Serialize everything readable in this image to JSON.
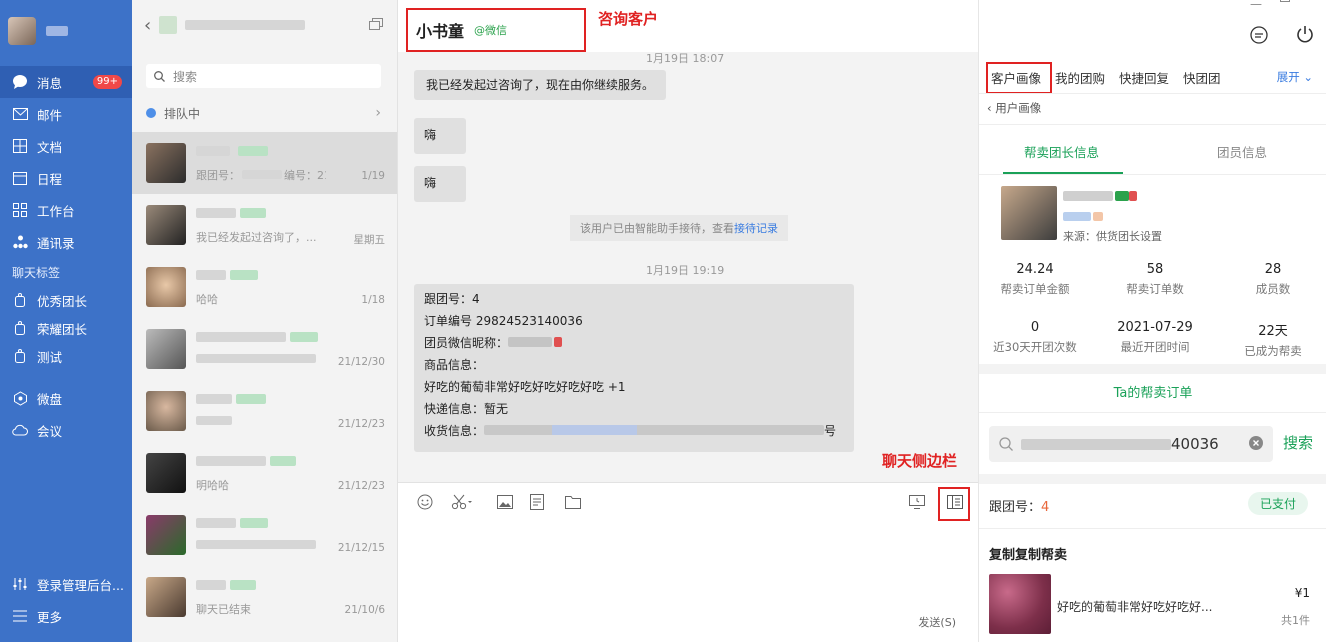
{
  "nav": {
    "items": [
      {
        "label": "消息",
        "badge": "99+"
      },
      {
        "label": "邮件"
      },
      {
        "label": "文档"
      },
      {
        "label": "日程"
      },
      {
        "label": "工作台"
      },
      {
        "label": "通讯录"
      }
    ],
    "section_label": "聊天标签",
    "tags": [
      {
        "label": "优秀团长"
      },
      {
        "label": "荣耀团长"
      },
      {
        "label": "测试"
      }
    ],
    "items2": [
      {
        "label": "微盘"
      },
      {
        "label": "会议"
      }
    ],
    "bottom": [
      {
        "label": "登录管理后台..."
      },
      {
        "label": "更多"
      }
    ]
  },
  "conversations": {
    "search_placeholder": "搜索",
    "queue_label": "排队中",
    "items": [
      {
        "preview": "跟团号：",
        "preview_tail": "编号：210...",
        "time": "1/19"
      },
      {
        "preview": "我已经发起过咨询了，...",
        "time": "星期五"
      },
      {
        "preview": "哈哈",
        "time": "1/18"
      },
      {
        "preview": "",
        "time": "21/12/30"
      },
      {
        "preview": "",
        "time": "21/12/23"
      },
      {
        "preview": "明哈哈",
        "time": "21/12/23"
      },
      {
        "preview": "",
        "time": "21/12/15"
      },
      {
        "preview": "聊天已结束",
        "time": "21/10/6"
      }
    ]
  },
  "chat": {
    "name": "小书童",
    "source": "@微信",
    "annotation_title": "咨询客户",
    "annotation_sidebar": "聊天侧边栏",
    "ts1": "1月19日 18:07",
    "msg1": "我已经发起过咨询了，现在由你继续服务。",
    "msg2": "嗨",
    "msg3": "嗨",
    "system_text": "该用户已由智能助手接待，查看",
    "system_link": "接待记录",
    "ts2": "1月19日 19:19",
    "order_lines": [
      "跟团号：4",
      "订单编号 29824523140036",
      "团员微信昵称：",
      "商品信息：",
      "好吃的葡萄非常好吃好吃好吃好吃 +1",
      "快递信息：暂无",
      "收货信息："
    ],
    "order_tail": "号",
    "send_label": "发送(S)"
  },
  "side": {
    "tabs": [
      "客户画像",
      "我的团购",
      "快捷回复",
      "快团团"
    ],
    "expand": "展开",
    "crumb": "用户画像",
    "subtab_on": "帮卖团长信息",
    "subtab_off": "团员信息",
    "source": "来源：供货团长设置",
    "stats": [
      {
        "v": "24.24",
        "k": "帮卖订单金额"
      },
      {
        "v": "58",
        "k": "帮卖订单数"
      },
      {
        "v": "28",
        "k": "成员数"
      },
      {
        "v": "0",
        "k": "近30天开团次数"
      },
      {
        "v": "2021-07-29",
        "k": "最近开团时间"
      },
      {
        "v": "22天",
        "k": "已成为帮卖"
      }
    ],
    "orders_title": "Ta的帮卖订单",
    "search_value_tail": "40036",
    "search_button": "搜索",
    "follow_label": "跟团号：",
    "follow_no": "4",
    "paid": "已支付",
    "group_title": "复制复制帮卖",
    "product": "好吃的葡萄非常好吃好吃好...",
    "price": "¥1",
    "qty": "共1件"
  }
}
